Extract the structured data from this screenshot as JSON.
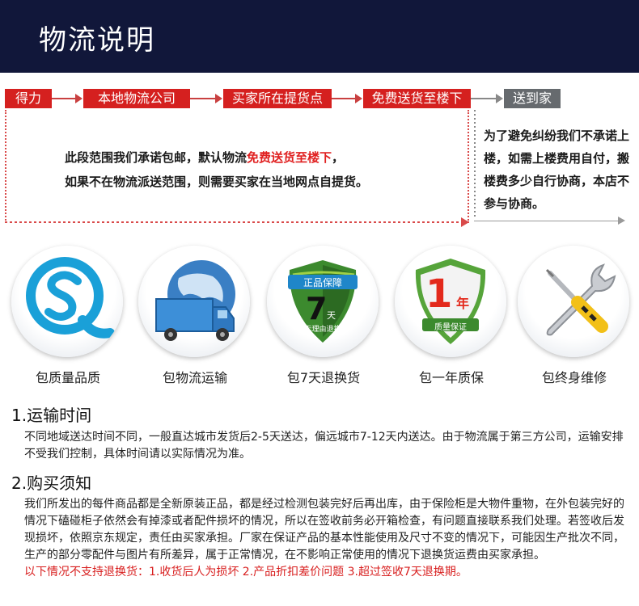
{
  "header": {
    "title": "物流说明"
  },
  "flow": {
    "steps": [
      "得力",
      "本地物流公司",
      "买家所在提货点",
      "免费送货至楼下",
      "送到家"
    ]
  },
  "range_note": {
    "line1_a": "此段范围我们承诺包邮，默认物流",
    "line1_highlight": "免费送货至楼下",
    "line1_b": "，",
    "line2": "如果不在物流派送范围，则需要买家在当地网点自提货。"
  },
  "upstairs_note": {
    "text": "为了避免纠纷我们不承诺上楼，如需上楼费用自付，搬楼费多少自行协商，本店不参与协商。"
  },
  "features": [
    {
      "label": "包质量品质",
      "icon": "quality-q-logo-icon"
    },
    {
      "label": "包物流运输",
      "icon": "globe-truck-icon"
    },
    {
      "label": "包7天退换货",
      "icon": "shield-7-day-icon",
      "badge_top": "正品保障",
      "badge_num": "7",
      "badge_unit": "天",
      "badge_sub": "无理由退换"
    },
    {
      "label": "包一年质保",
      "icon": "shield-1-year-icon",
      "badge_num": "1",
      "badge_unit": "年",
      "badge_sub": "质量保证"
    },
    {
      "label": "包终身维修",
      "icon": "wrench-screwdriver-icon"
    }
  ],
  "shipping": {
    "title": "1.运输时间",
    "body": "不同地域送达时间不同，一般直达城市发货后2-5天送达，偏远城市7-12天内送达。由于物流属于第三方公司，运输安排不受我们控制，具体时间请以实际情况为准。"
  },
  "purchase": {
    "title": "2.购买须知",
    "body": "我们所发出的每件商品都是全新原装正品，都是经过检测包装完好后再出库，由于保险柜是大物件重物，在外包装完好的情况下磕碰柜子依然会有掉漆或者配件损坏的情况，所以在签收前务必开箱检查，有问题直接联系我们处理。若签收后发现损坏，依照京东规定，责任由买家承担。厂家在保证产品的基本性能使用及尺寸不变的情况下，可能因生产批次不同，生产的部分零配件与图片有所差异，属于正常情况，在不影响正常使用的情况下退换货运费由买家承担。",
    "notice": "以下情况不支持退换货：1.收货后人为损坏  2.产品折扣差价问题  3.超过签收7天退换期。"
  },
  "colors": {
    "header_bg": "#11173a",
    "accent_red": "#d5201f",
    "gray_step": "#666a6e"
  }
}
